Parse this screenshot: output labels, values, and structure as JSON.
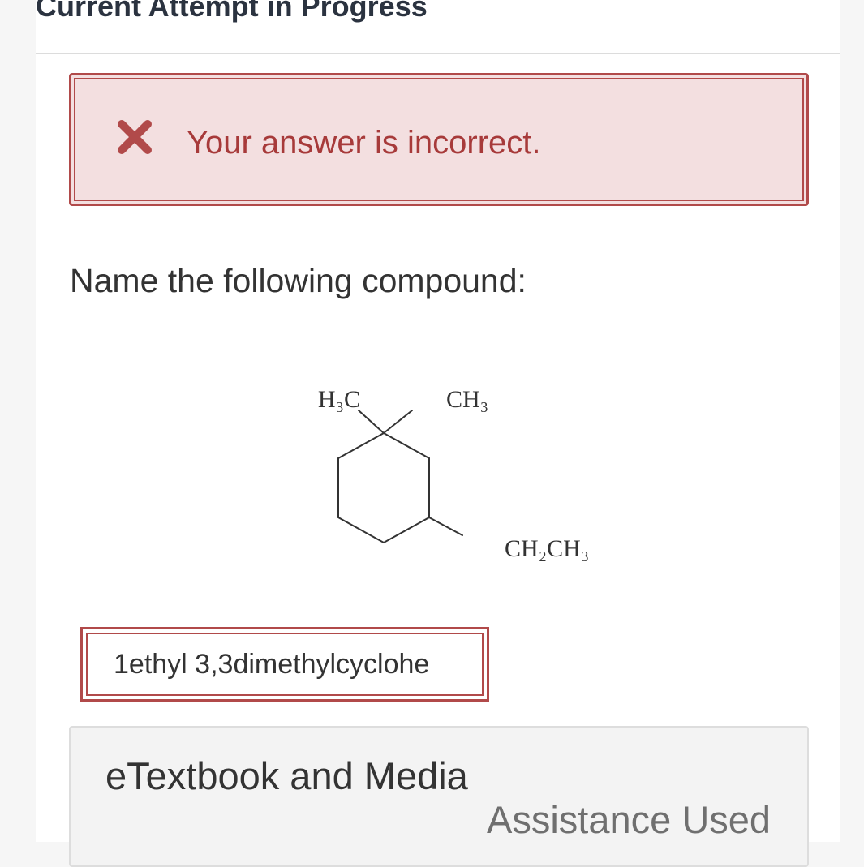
{
  "header": {
    "title": "Current Attempt in Progress"
  },
  "alert": {
    "icon": "close-x-icon",
    "message": "Your answer is incorrect.",
    "color": "#a73a3a",
    "background": "#f3dfe0"
  },
  "question": {
    "prompt": "Name the following compound:",
    "structure": {
      "label_top_left": "H₃C",
      "label_top_right": "CH₃",
      "label_bottom_right": "CH₂CH₃"
    }
  },
  "answer": {
    "value": "1ethyl 3,3dimethylcyclohe"
  },
  "media": {
    "title": "eTextbook and Media",
    "assistance": "Assistance Used"
  }
}
